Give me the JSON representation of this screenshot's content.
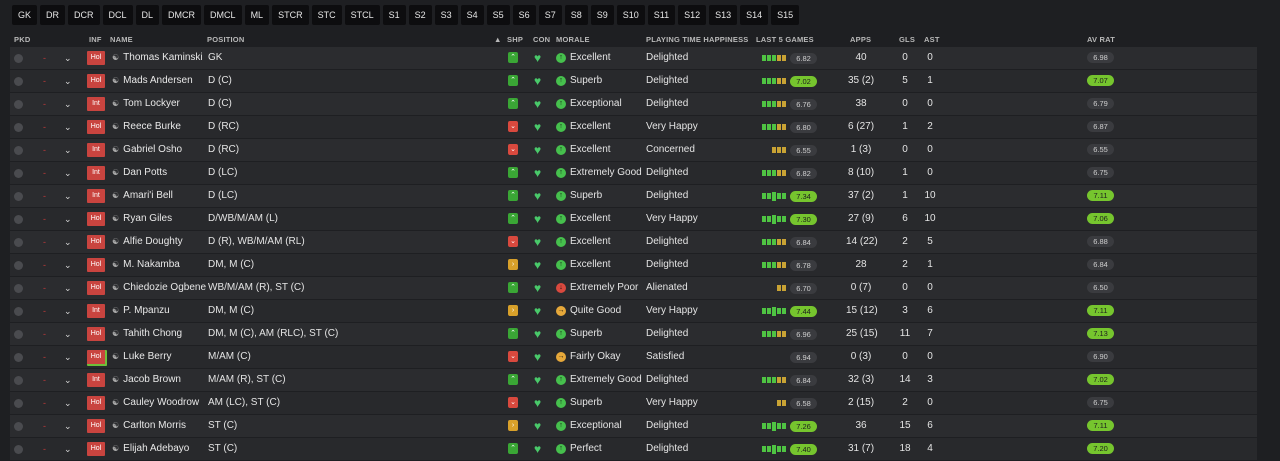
{
  "positions": [
    "GK",
    "DR",
    "DCR",
    "DCL",
    "DL",
    "DMCR",
    "DMCL",
    "ML",
    "STCR",
    "STC",
    "STCL",
    "S1",
    "S2",
    "S3",
    "S4",
    "S5",
    "S6",
    "S7",
    "S8",
    "S9",
    "S10",
    "S11",
    "S12",
    "S13",
    "S14",
    "S15"
  ],
  "headers": {
    "pkd": "PKD",
    "inf": "INF",
    "name": "NAME",
    "position": "POSITION",
    "sort": "▲",
    "shp": "SHP",
    "con": "CON",
    "morale": "MORALE",
    "pth": "PLAYING TIME HAPPINESS",
    "last5": "LAST 5 GAMES",
    "apps": "APPS",
    "gls": "GLS",
    "ast": "AST",
    "avrat": "AV RAT"
  },
  "colors": {
    "accent": "#76c52e",
    "inf_badge": "#c9443f",
    "shp_up": "#3aa635",
    "shp_down": "#d9493e",
    "shp_side": "#d8a02a"
  },
  "rows": [
    {
      "inf": "Hol",
      "name": "Thomas Kaminski",
      "position": "GK",
      "shp": "up",
      "morale": "Excellent",
      "mor": "g",
      "pth": "Delighted",
      "games": "gggyy",
      "last": "6.82",
      "last_hi": false,
      "apps": "40",
      "gls": "0",
      "ast": "0",
      "av": "6.98",
      "av_hi": false
    },
    {
      "inf": "Hol",
      "name": "Mads Andersen",
      "position": "D (C)",
      "shp": "up",
      "morale": "Superb",
      "mor": "g",
      "pth": "Delighted",
      "games": "gggyy",
      "last": "7.02",
      "last_hi": true,
      "apps": "35 (2)",
      "gls": "5",
      "ast": "1",
      "av": "7.07",
      "av_hi": true
    },
    {
      "inf": "Int",
      "name": "Tom Lockyer",
      "position": "D (C)",
      "shp": "up",
      "morale": "Exceptional",
      "mor": "g",
      "pth": "Delighted",
      "games": "gggyy",
      "last": "6.76",
      "last_hi": false,
      "apps": "38",
      "gls": "0",
      "ast": "0",
      "av": "6.79",
      "av_hi": false
    },
    {
      "inf": "Hol",
      "name": "Reece Burke",
      "position": "D (RC)",
      "shp": "down",
      "morale": "Excellent",
      "mor": "g",
      "pth": "Very Happy",
      "games": "gggyy",
      "last": "6.80",
      "last_hi": false,
      "apps": "6 (27)",
      "gls": "1",
      "ast": "2",
      "av": "6.87",
      "av_hi": false
    },
    {
      "inf": "Int",
      "name": "Gabriel Osho",
      "position": "D (RC)",
      "shp": "down",
      "morale": "Excellent",
      "mor": "g",
      "pth": "Concerned",
      "games": "yyy",
      "last": "6.55",
      "last_hi": false,
      "apps": "1 (3)",
      "gls": "0",
      "ast": "0",
      "av": "6.55",
      "av_hi": false
    },
    {
      "inf": "Int",
      "name": "Dan Potts",
      "position": "D (LC)",
      "shp": "up",
      "morale": "Extremely Good",
      "mor": "g",
      "pth": "Delighted",
      "games": "gggyy",
      "last": "6.82",
      "last_hi": false,
      "apps": "8 (10)",
      "gls": "1",
      "ast": "0",
      "av": "6.75",
      "av_hi": false
    },
    {
      "inf": "Int",
      "name": "Amari'i Bell",
      "position": "D (LC)",
      "shp": "up",
      "morale": "Superb",
      "mor": "g",
      "pth": "Delighted",
      "games": "ggTgg",
      "last": "7.34",
      "last_hi": true,
      "apps": "37 (2)",
      "gls": "1",
      "ast": "10",
      "av": "7.11",
      "av_hi": true
    },
    {
      "inf": "Hol",
      "name": "Ryan Giles",
      "position": "D/WB/M/AM (L)",
      "shp": "up",
      "morale": "Excellent",
      "mor": "g",
      "pth": "Very Happy",
      "games": "ggTgg",
      "last": "7.30",
      "last_hi": true,
      "apps": "27 (9)",
      "gls": "6",
      "ast": "10",
      "av": "7.06",
      "av_hi": true
    },
    {
      "inf": "Hol",
      "name": "Alfie Doughty",
      "position": "D (R), WB/M/AM (RL)",
      "shp": "down",
      "morale": "Excellent",
      "mor": "g",
      "pth": "Delighted",
      "games": "gggyy",
      "last": "6.84",
      "last_hi": false,
      "apps": "14 (22)",
      "gls": "2",
      "ast": "5",
      "av": "6.88",
      "av_hi": false
    },
    {
      "inf": "Hol",
      "name": "M. Nakamba",
      "position": "DM, M (C)",
      "shp": "side",
      "morale": "Excellent",
      "mor": "g",
      "pth": "Delighted",
      "games": "gggyy",
      "last": "6.78",
      "last_hi": false,
      "apps": "28",
      "gls": "2",
      "ast": "1",
      "av": "6.84",
      "av_hi": false
    },
    {
      "inf": "Hol",
      "name": "Chiedozie Ogbene",
      "position": "WB/M/AM (R), ST (C)",
      "shp": "up",
      "morale": "Extremely Poor",
      "mor": "r",
      "pth": "Alienated",
      "games": "yy",
      "last": "6.70",
      "last_hi": false,
      "apps": "0 (7)",
      "gls": "0",
      "ast": "0",
      "av": "6.50",
      "av_hi": false
    },
    {
      "inf": "Int",
      "name": "P. Mpanzu",
      "position": "DM, M (C)",
      "shp": "side",
      "morale": "Quite Good",
      "mor": "o",
      "pth": "Very Happy",
      "games": "ggTgg",
      "last": "7.44",
      "last_hi": true,
      "apps": "15 (12)",
      "gls": "3",
      "ast": "6",
      "av": "7.11",
      "av_hi": true
    },
    {
      "inf": "Hol",
      "name": "Tahith Chong",
      "position": "DM, M (C), AM (RLC), ST (C)",
      "shp": "up",
      "morale": "Superb",
      "mor": "g",
      "pth": "Delighted",
      "games": "gggyy",
      "last": "6.96",
      "last_hi": false,
      "apps": "25 (15)",
      "gls": "11",
      "ast": "7",
      "av": "7.13",
      "av_hi": true
    },
    {
      "inf": "Hol",
      "name": "Luke Berry",
      "position": "M/AM (C)",
      "shp": "down",
      "morale": "Fairly Okay",
      "mor": "o",
      "pth": "Satisfied",
      "games": "",
      "last": "6.94",
      "last_hi": false,
      "apps": "0 (3)",
      "gls": "0",
      "ast": "0",
      "av": "6.90",
      "av_hi": false
    },
    {
      "inf": "Int",
      "name": "Jacob Brown",
      "position": "M/AM (R), ST (C)",
      "shp": "up",
      "morale": "Extremely Good",
      "mor": "g",
      "pth": "Delighted",
      "games": "gggyy",
      "last": "6.84",
      "last_hi": false,
      "apps": "32 (3)",
      "gls": "14",
      "ast": "3",
      "av": "7.02",
      "av_hi": true
    },
    {
      "inf": "Hol",
      "name": "Cauley Woodrow",
      "position": "AM (LC), ST (C)",
      "shp": "down",
      "morale": "Superb",
      "mor": "g",
      "pth": "Very Happy",
      "games": "yy",
      "last": "6.58",
      "last_hi": false,
      "apps": "2 (15)",
      "gls": "2",
      "ast": "0",
      "av": "6.75",
      "av_hi": false
    },
    {
      "inf": "Hol",
      "name": "Carlton Morris",
      "position": "ST (C)",
      "shp": "side",
      "morale": "Exceptional",
      "mor": "g",
      "pth": "Delighted",
      "games": "ggTgg",
      "last": "7.26",
      "last_hi": true,
      "apps": "36",
      "gls": "15",
      "ast": "6",
      "av": "7.11",
      "av_hi": true
    },
    {
      "inf": "Hol",
      "name": "Elijah Adebayo",
      "position": "ST (C)",
      "shp": "up",
      "morale": "Perfect",
      "mor": "g",
      "pth": "Delighted",
      "games": "ggTgg",
      "last": "7.40",
      "last_hi": true,
      "apps": "31 (7)",
      "gls": "18",
      "ast": "4",
      "av": "7.20",
      "av_hi": true
    }
  ]
}
